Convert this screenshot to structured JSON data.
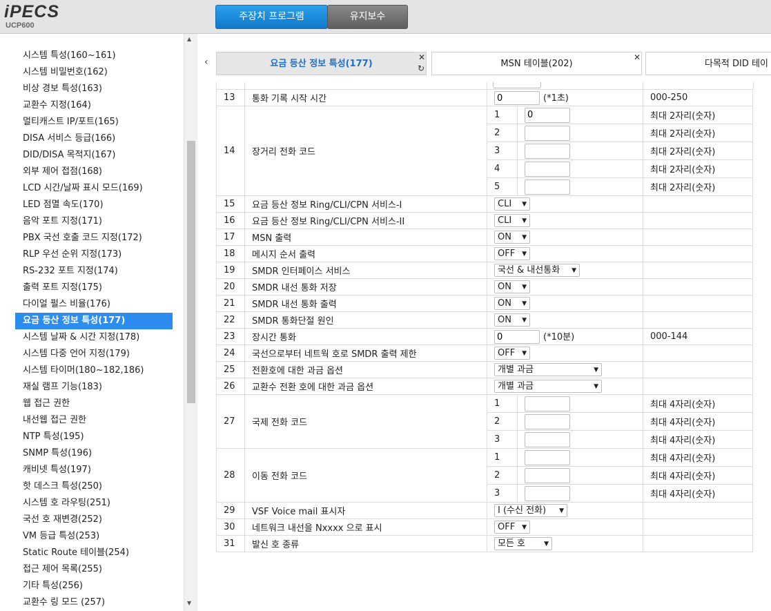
{
  "header": {
    "logo": "iPECS",
    "model": "UCP600",
    "main_tab": "주장치 프로그램",
    "maint_tab": "유지보수"
  },
  "sidebar": {
    "items": [
      "시스템 특성(160~161)",
      "시스템 비밀번호(162)",
      "비상 경보 특성(163)",
      "교환수 지정(164)",
      "멀티캐스트 IP/포트(165)",
      "DISA 서비스 등급(166)",
      "DID/DISA 목적지(167)",
      "외부 제어 접점(168)",
      "LCD 시간/날짜 표시 모드(169)",
      "LED 점멸 속도(170)",
      "음악 포트 지정(171)",
      "PBX 국선 호출 코드 지정(172)",
      "RLP 우선 순위 지정(173)",
      "RS-232 포트 지정(174)",
      "출력 포트 지정(175)",
      "다이얼 펄스 비율(176)",
      "요금 등산 정보 특성(177)",
      "시스템 날짜 & 시간 지정(178)",
      "시스템 다중 언어 지정(179)",
      "시스템 타이머(180~182,186)",
      "재실 램프 기능(183)",
      "웹 접근 권한",
      "내선웹 접근 권한",
      "NTP 특성(195)",
      "SNMP 특성(196)",
      "캐비넷 특성(197)",
      "핫 데스크 특성(250)",
      "시스템 호 라우팅(251)",
      "국선 호 재변경(252)",
      "VM 등급 특성(253)",
      "Static Route 테이블(254)",
      "접근 제어 목록(255)",
      "기타 특성(256)",
      "교환수 링 모드 (257)"
    ],
    "active_index": 16
  },
  "tabs": [
    {
      "label": "요금 등산 정보 특성(177)",
      "active": true
    },
    {
      "label": "MSN 테이블(202)",
      "active": false
    },
    {
      "label": "다목적 DID 테이",
      "active": false
    }
  ],
  "table": {
    "row13": {
      "num": "13",
      "label": "통화 기록 시작 시간",
      "value": "0",
      "unit": "(*1초)",
      "range": "000-250"
    },
    "row14": {
      "num": "14",
      "label": "장거리 전화 코드",
      "subs": [
        "1",
        "2",
        "3",
        "4",
        "5"
      ],
      "first_value": "0",
      "range": "최대 2자리(숫자)"
    },
    "simple": [
      {
        "num": "15",
        "label": "요금 등산 정보 Ring/CLI/CPN 서비스-I",
        "sel": "CLI"
      },
      {
        "num": "16",
        "label": "요금 등산 정보 Ring/CLI/CPN 서비스-II",
        "sel": "CLI"
      },
      {
        "num": "17",
        "label": "MSN 출력",
        "sel": "ON"
      },
      {
        "num": "18",
        "label": "메시지 순서 출력",
        "sel": "OFF"
      },
      {
        "num": "19",
        "label": "SMDR 인터페이스 서비스",
        "sel": "국선 & 내선통화"
      },
      {
        "num": "20",
        "label": "SMDR 내선 통화 저장",
        "sel": "ON"
      },
      {
        "num": "21",
        "label": "SMDR 내선 통화 출력",
        "sel": "ON"
      },
      {
        "num": "22",
        "label": "SMDR 통화단절 원인",
        "sel": "ON"
      }
    ],
    "row23": {
      "num": "23",
      "label": "장시간 통화",
      "value": "0",
      "unit": "(*10분)",
      "range": "000-144"
    },
    "simple2": [
      {
        "num": "24",
        "label": "국선으로부터 네트웍 호로 SMDR 출력 제한",
        "sel": "OFF"
      },
      {
        "num": "25",
        "label": "전환호에 대한 과금 옵션",
        "sel": "개별 과금"
      },
      {
        "num": "26",
        "label": "교환수 전환 호에 대한 과금 옵션",
        "sel": "개별 과금"
      }
    ],
    "row27": {
      "num": "27",
      "label": "국제 전화 코드",
      "subs": [
        "1",
        "2",
        "3"
      ],
      "range": "최대 4자리(숫자)"
    },
    "row28": {
      "num": "28",
      "label": "이동 전화 코드",
      "subs": [
        "1",
        "2",
        "3"
      ],
      "range": "최대 4자리(숫자)"
    },
    "simple3": [
      {
        "num": "29",
        "label": "VSF Voice mail 표시자",
        "sel": "I (수신 전화)"
      },
      {
        "num": "30",
        "label": "네트워크 내선을 Nxxxx 으로 표시",
        "sel": "OFF"
      },
      {
        "num": "31",
        "label": "발신 호 종류",
        "sel": "모든 호"
      }
    ]
  }
}
